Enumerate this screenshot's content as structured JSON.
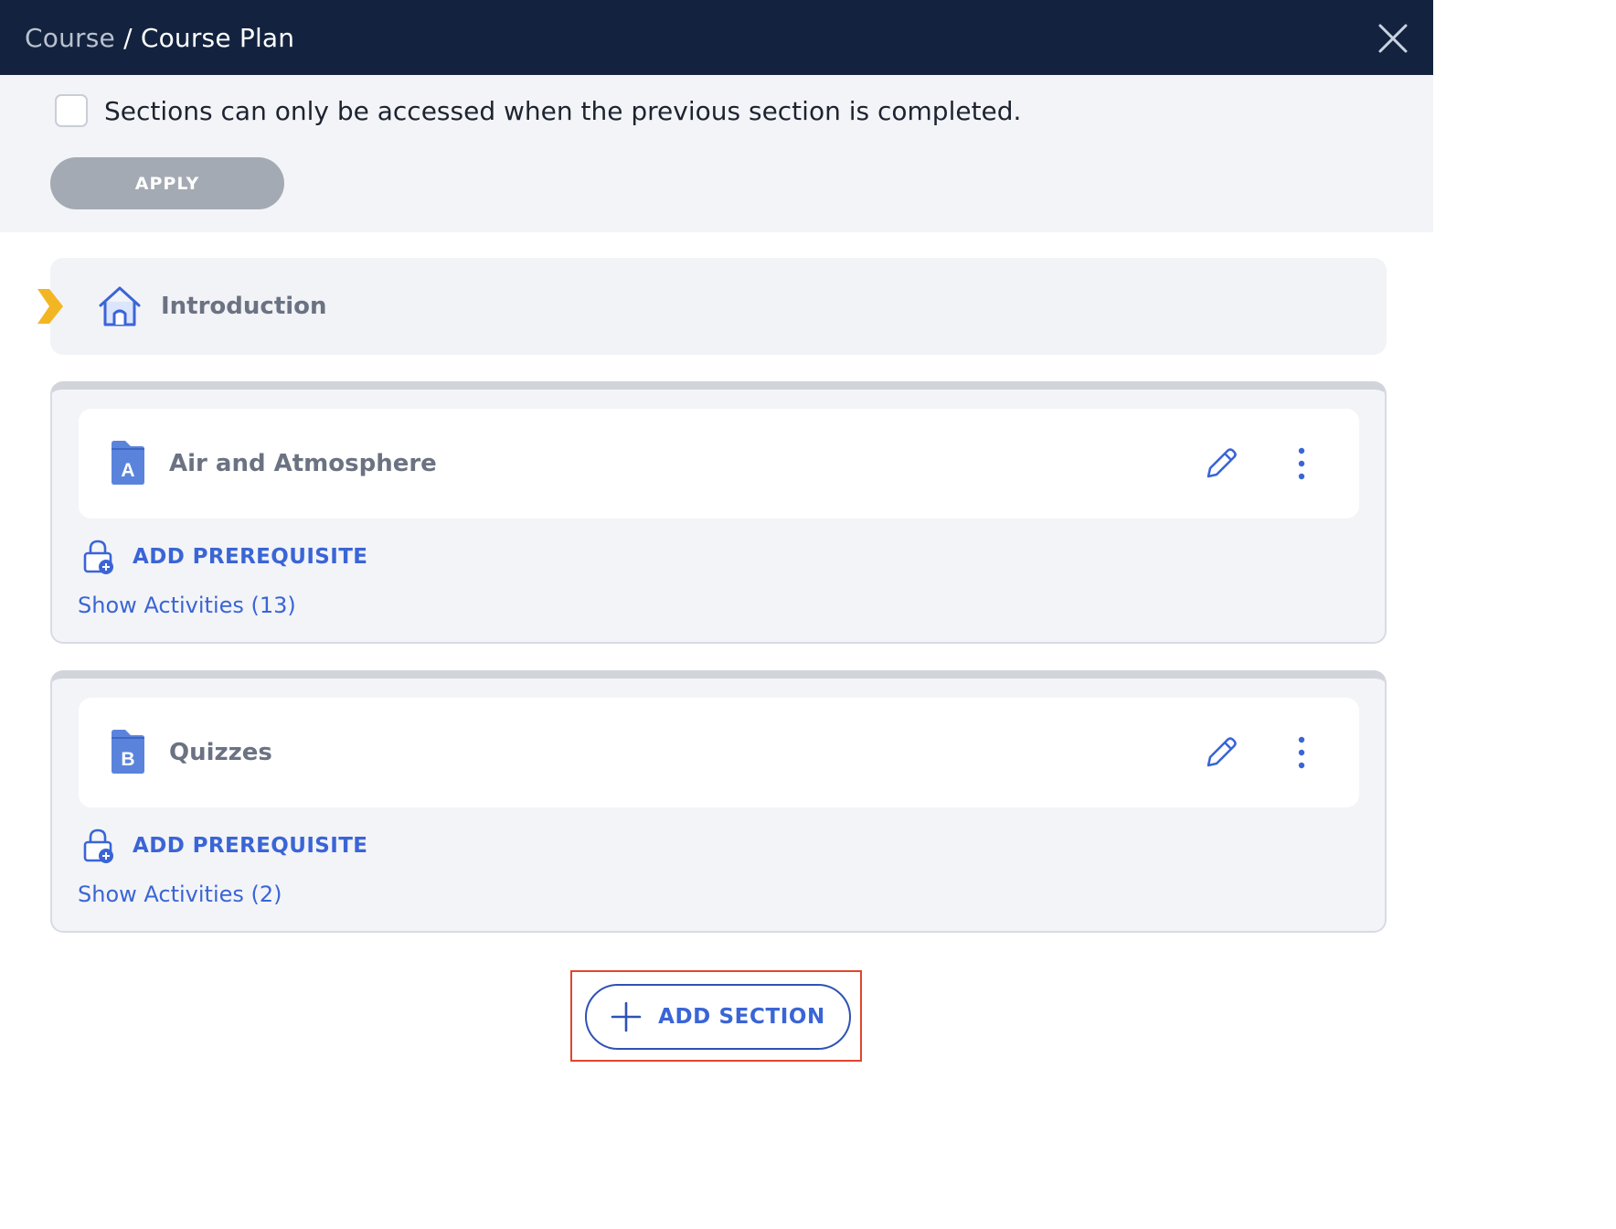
{
  "header": {
    "breadcrumb_root": "Course",
    "breadcrumb_separator": " / ",
    "breadcrumb_current": "Course Plan",
    "close_icon": "close-icon"
  },
  "options": {
    "checkbox_checked": false,
    "checkbox_label": "Sections can only be accessed when the previous section is completed.",
    "apply_label": "APPLY"
  },
  "introduction": {
    "title": "Introduction",
    "icon": "home-icon"
  },
  "sections": [
    {
      "letter": "A",
      "title": "Air and Atmosphere",
      "prereq_label": "ADD PREREQUISITE",
      "show_activities": "Show Activities (13)"
    },
    {
      "letter": "B",
      "title": "Quizzes",
      "prereq_label": "ADD PREREQUISITE",
      "show_activities": "Show Activities (2)"
    }
  ],
  "add_section": {
    "label": "ADD SECTION"
  },
  "colors": {
    "header_bg": "#13233f",
    "accent_blue": "#3a65d6",
    "folder_blue": "#5a84dc",
    "arrow_yellow": "#f3b623",
    "highlight_red": "#e0452c"
  }
}
